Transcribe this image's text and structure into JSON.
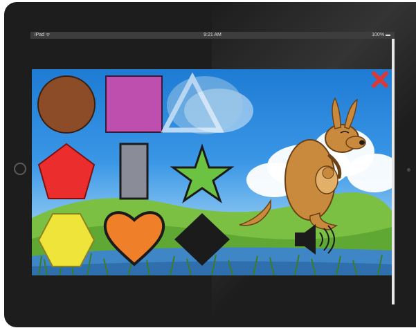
{
  "status_bar": {
    "carrier": "iPad ᯤ",
    "time": "9:21 AM",
    "battery": "100% ▬"
  },
  "game": {
    "shapes": [
      {
        "name": "circle",
        "color": "#8b4c27"
      },
      {
        "name": "square",
        "color": "#bf4fae"
      },
      {
        "name": "triangle",
        "color": "#ffffff",
        "state": "hint-faded"
      },
      {
        "name": "pentagon",
        "color": "#ec2d2d"
      },
      {
        "name": "rectangle",
        "color": "#8a8d97"
      },
      {
        "name": "star",
        "color": "#6cc241"
      },
      {
        "name": "hexagon",
        "color": "#efe43a"
      },
      {
        "name": "heart",
        "color": "#f07f2a"
      },
      {
        "name": "diamond",
        "color": "#1b1b1b"
      }
    ],
    "close_icon": "close-icon",
    "close_color": "#d83a3a",
    "speaker_icon": "speaker-icon",
    "mascot": "kangaroo",
    "mascot_color": "#c98a3e"
  }
}
